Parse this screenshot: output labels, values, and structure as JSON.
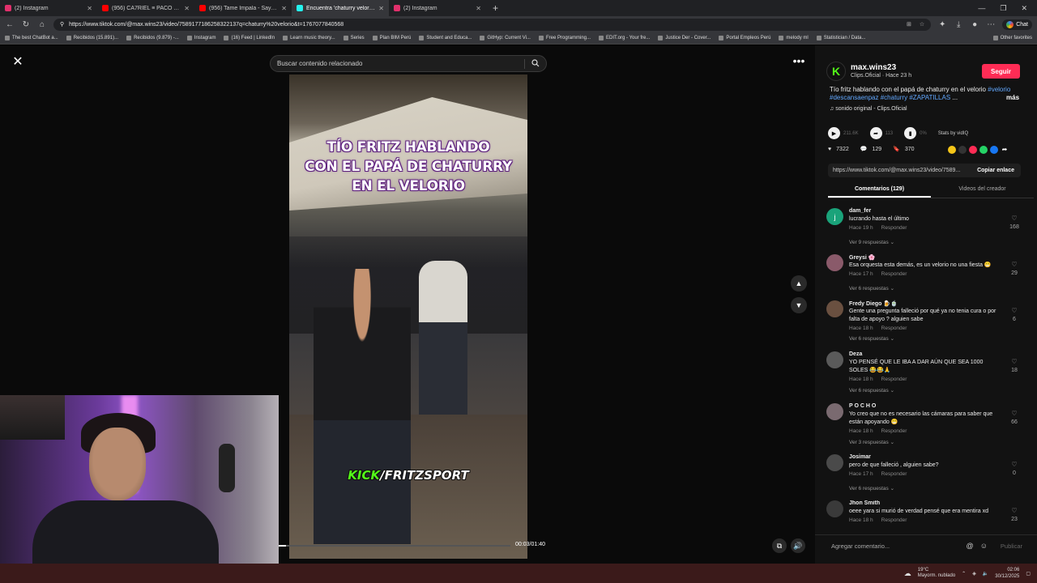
{
  "browser": {
    "tabs": [
      {
        "label": "(2) Instagram",
        "color": "#e1306c"
      },
      {
        "label": "(956) CA7RIEL ≡ PACO AMOROSO",
        "color": "#ff0000"
      },
      {
        "label": "(956) Tame Impala - Say It Righ",
        "color": "#ff0000"
      },
      {
        "label": "Encuentra 'chaturry velorio' en",
        "color": "#25f4ee"
      },
      {
        "label": "(2) Instagram",
        "color": "#e1306c"
      }
    ],
    "url": "https://www.tiktok.com/@max.wins23/video/7589177186258322137q=chaturry%20velorio&t=1767077840568",
    "chat_label": "Chat",
    "bookmarks": [
      "The best ChatBot a...",
      "Recibidos (15.891)...",
      "Recibidos (9.879) -...",
      "Instagram",
      "(16) Feed | LinkedIn",
      "Learn music theory...",
      "Series",
      "Plan BIM Perú",
      "Student and Educa...",
      "GitHyp: Current Vi...",
      "Free Programming...",
      "EDIT.org - Your fre...",
      "Justice Der - Cover...",
      "Portal Empleos Perú",
      "melody ml",
      "Statistician / Data..."
    ],
    "other_favorites": "Other favorites"
  },
  "player": {
    "search_placeholder": "Buscar contenido relacionado",
    "overlay_line1": "TÍO FRITZ HABLANDO",
    "overlay_line2": "CON EL PAPÁ DE CHATURRY",
    "overlay_line3": "EN EL VELORIO",
    "kick_prefix": "KICK",
    "kick_suffix": "/FRITZSPORT",
    "timecode": "00:03/01:40",
    "progress_fraction": 0.03
  },
  "creator": {
    "username": "max.wins23",
    "subline": "Clips.Oficial · Hace 23 h",
    "follow_label": "Seguir",
    "description": "Tío fritz hablando con el papá de chaturry en el velorio",
    "hashtags": [
      "#velorio",
      "#descansaenpaz",
      "#chaturry",
      "#ZAPATILLAS"
    ],
    "ellipsis": "...",
    "more_label": "más",
    "sound": "sonido original - Clips.Oficial"
  },
  "stats": {
    "plays": "211.6K",
    "shares": "113",
    "ratio": "0%",
    "stats_by": "Stats by vidIQ",
    "likes": "7322",
    "comments": "129",
    "saves": "370"
  },
  "link": {
    "url": "https://www.tiktok.com/@max.wins23/video/7589...",
    "copy_label": "Copiar enlace"
  },
  "panel_tabs": {
    "comments": "Comentarios (129)",
    "creator_videos": "Videos del creador"
  },
  "comments": [
    {
      "user": "dam_fer",
      "text": "lucrando hasta el último",
      "time": "Hace 19 h",
      "reply": "Responder",
      "replies": "Ver 9 respuestas",
      "likes": "168",
      "color": "#1aa37a"
    },
    {
      "user": "Greysi 🌸",
      "text": "Esa orquesta esta demás, es un velorio no una fiesta 😁",
      "time": "Hace 17 h",
      "reply": "Responder",
      "replies": "Ver 6 respuestas",
      "likes": "29",
      "color": "#8a5a6a"
    },
    {
      "user": "Fredy Diego 🍺🍵",
      "text": "Gente una pregunta falleció por qué ya no tenia cura o por falta de apoyo ? alguien sabe",
      "time": "Hace 18 h",
      "reply": "Responder",
      "replies": "Ver 6 respuestas",
      "likes": "6",
      "color": "#6a5040"
    },
    {
      "user": "Deza",
      "text": "YO PENSÉ QUE LE IBA A DAR AÚN QUE SEA 1000 SOLES 😂😂🙏",
      "time": "Hace 18 h",
      "reply": "Responder",
      "replies": "Ver 6 respuestas",
      "likes": "18",
      "color": "#5a5a5a"
    },
    {
      "user": "P O C H O",
      "text": "Yo creo que no es necesario las cámaras para saber que están apoyando 😁",
      "time": "Hace 18 h",
      "reply": "Responder",
      "replies": "Ver 3 respuestas",
      "likes": "66",
      "color": "#7a6a70"
    },
    {
      "user": "Josimar",
      "text": "pero de que falleció , alguien sabe?",
      "time": "Hace 17 h",
      "reply": "Responder",
      "replies": "Ver 6 respuestas",
      "likes": "0",
      "color": "#4a4a4a"
    },
    {
      "user": "Jhon Smith",
      "text": "oeee yara si murió de verdad pensé que era mentira xd",
      "time": "Hace 18 h",
      "reply": "Responder",
      "replies": "",
      "likes": "23",
      "color": "#3a3a3a"
    }
  ],
  "composer": {
    "placeholder": "Agregar comentario...",
    "publish": "Publicar"
  },
  "taskbar": {
    "temp": "19°C",
    "weather": "Mayorm. nublado",
    "time": "02:06",
    "date": "30/12/2025"
  }
}
